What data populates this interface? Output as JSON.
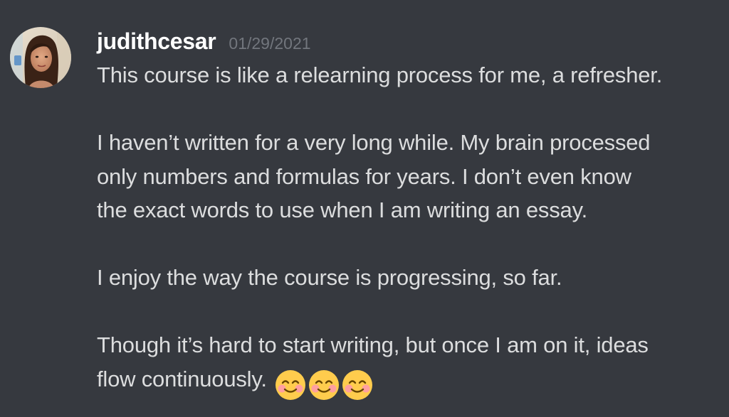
{
  "message": {
    "author": "judithcesar",
    "timestamp": "01/29/2021",
    "avatar_icon": "user-avatar-photo",
    "paragraphs": [
      {
        "lines": [
          "This course is like a relearning process for me, a refresher."
        ]
      },
      {
        "lines": [
          "I haven’t written for a very long while. My brain processed",
          "only numbers and formulas for years. I don’t even know",
          "the exact words to use when I am writing an essay."
        ]
      },
      {
        "lines": [
          "I enjoy the way the course is progressing, so far."
        ]
      },
      {
        "lines": [
          "Though it’s hard to start writing, but once I am on it, ideas",
          "flow continuously."
        ]
      }
    ],
    "emojis": [
      "smiling-face-with-smiling-eyes-icon",
      "smiling-face-with-smiling-eyes-icon",
      "smiling-face-with-smiling-eyes-icon"
    ]
  },
  "colors": {
    "background": "#36393f",
    "username": "#ffffff",
    "timestamp": "#72767d",
    "text": "#dcddde"
  }
}
